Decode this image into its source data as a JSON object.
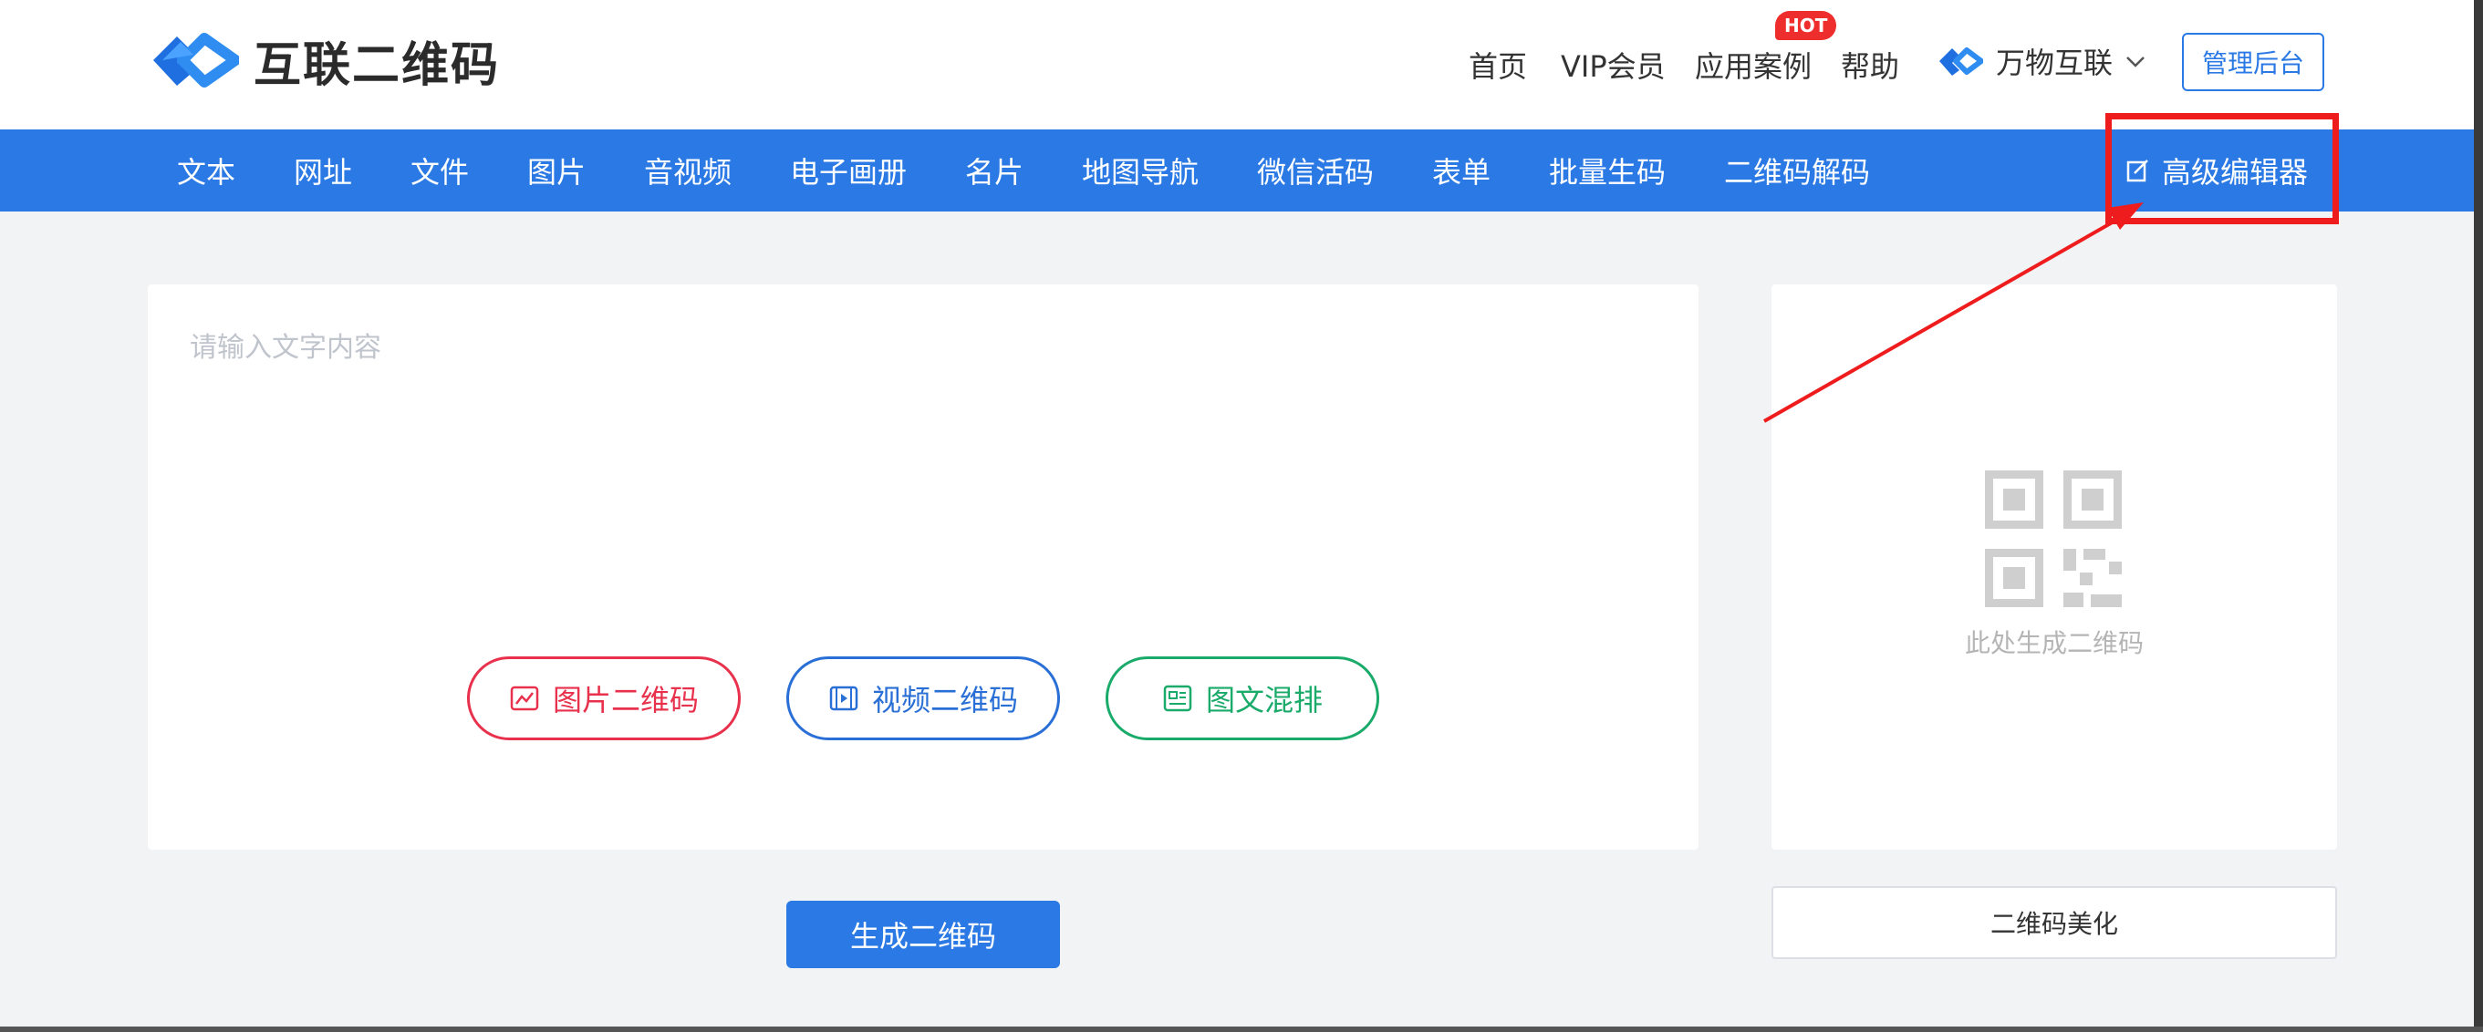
{
  "header": {
    "logo_text": "互联二维码",
    "nav": [
      {
        "label": "首页"
      },
      {
        "label": "VIP会员"
      },
      {
        "label": "应用案例"
      },
      {
        "label": "帮助"
      }
    ],
    "hot_badge": "HOT",
    "brand_switch": {
      "label": "万物互联",
      "icon": "chevron-down-icon"
    },
    "admin_button": "管理后台"
  },
  "navbar": {
    "items": [
      {
        "label": "文本"
      },
      {
        "label": "网址"
      },
      {
        "label": "文件"
      },
      {
        "label": "图片"
      },
      {
        "label": "音视频"
      },
      {
        "label": "电子画册"
      },
      {
        "label": "名片"
      },
      {
        "label": "地图导航"
      },
      {
        "label": "微信活码"
      },
      {
        "label": "表单"
      },
      {
        "label": "批量生码"
      },
      {
        "label": "二维码解码"
      }
    ],
    "advanced_editor": "高级编辑器"
  },
  "editor": {
    "placeholder": "请输入文字内容",
    "value": "",
    "buttons": {
      "image_qr": "图片二维码",
      "video_qr": "视频二维码",
      "mixed": "图文混排"
    },
    "generate": "生成二维码"
  },
  "preview": {
    "caption": "此处生成二维码",
    "beautify": "二维码美化"
  },
  "colors": {
    "primary": "#2a79e4",
    "red": "#e8314c",
    "green": "#1aaa6a",
    "annotation": "#ee1c1c"
  }
}
